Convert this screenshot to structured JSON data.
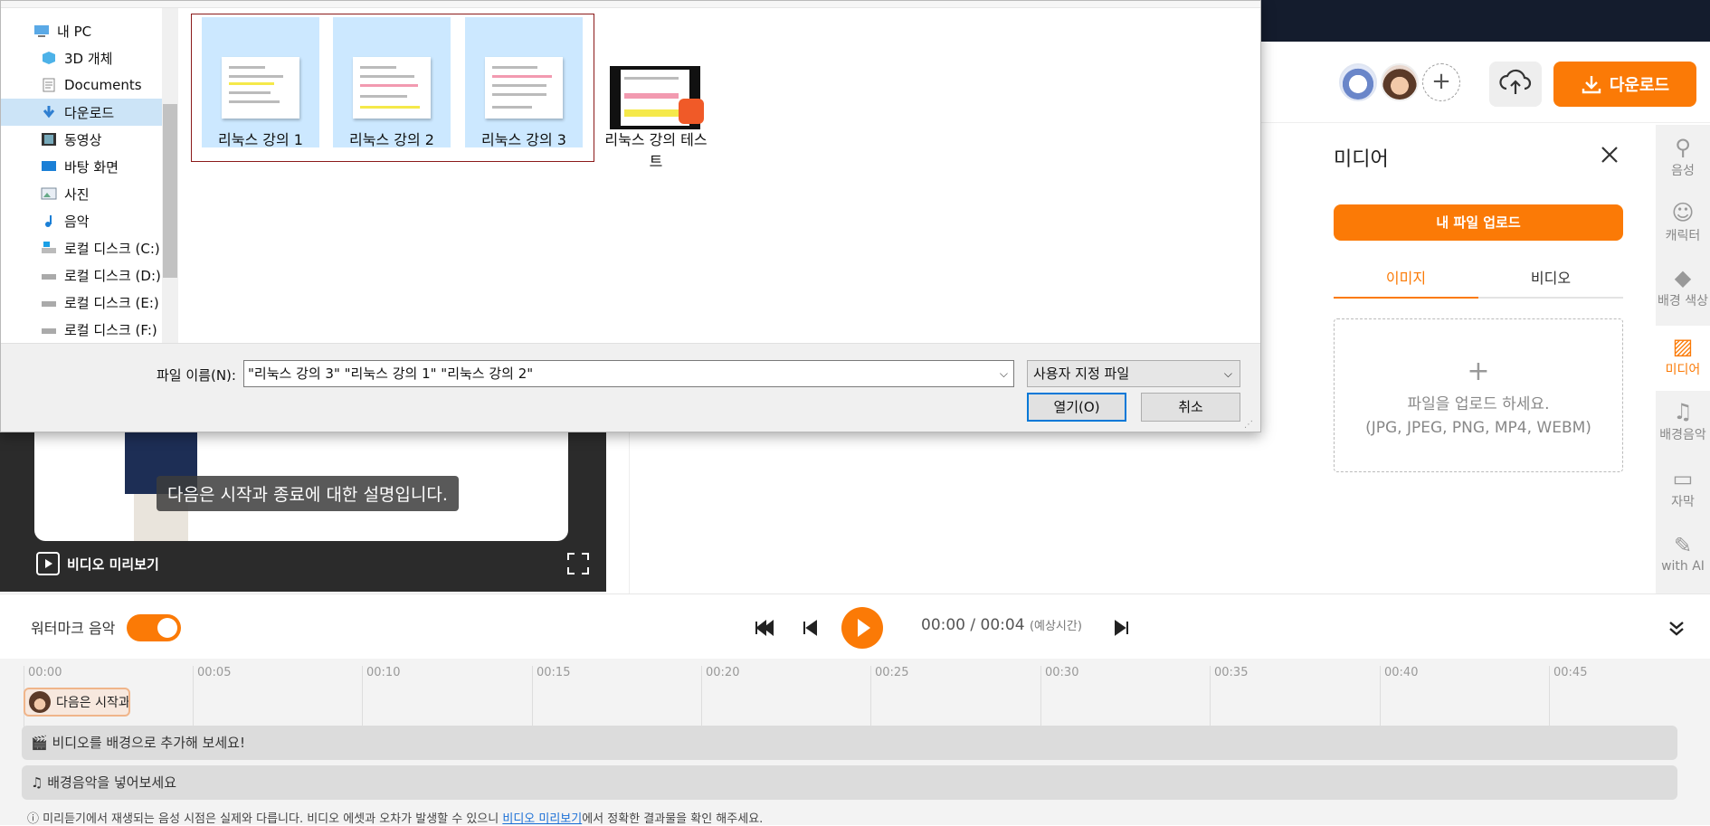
{
  "dialog": {
    "nav_items": [
      {
        "label": "내 PC",
        "icon": "pc-icon"
      },
      {
        "label": "3D 개체",
        "icon": "cube-icon"
      },
      {
        "label": "Documents",
        "icon": "document-icon"
      },
      {
        "label": "다운로드",
        "icon": "download-arrow-icon",
        "selected": true
      },
      {
        "label": "동영상",
        "icon": "film-icon"
      },
      {
        "label": "바탕 화면",
        "icon": "desktop-icon"
      },
      {
        "label": "사진",
        "icon": "picture-icon"
      },
      {
        "label": "음악",
        "icon": "music-note-icon"
      },
      {
        "label": "로컬 디스크 (C:)",
        "icon": "windows-drive-icon"
      },
      {
        "label": "로컬 디스크 (D:)",
        "icon": "drive-icon"
      },
      {
        "label": "로컬 디스크 (E:)",
        "icon": "drive-icon"
      },
      {
        "label": "로컬 디스크 (F:)",
        "icon": "drive-icon"
      }
    ],
    "files": [
      {
        "name": "리눅스 강의 1",
        "selected": true
      },
      {
        "name": "리눅스 강의 2",
        "selected": true
      },
      {
        "name": "리눅스 강의 3",
        "selected": true
      },
      {
        "name": "리눅스 강의 테스트",
        "selected": false
      }
    ],
    "filename_label": "파일 이름(N):",
    "filename_value": "\"리눅스 강의 3\" \"리눅스 강의 1\" \"리눅스 강의 2\"",
    "filetype_value": "사용자 지정 파일",
    "open_label": "열기(O)",
    "cancel_label": "취소"
  },
  "header": {
    "download_label": "다운로드",
    "add_icon": "plus-icon",
    "upload_icon": "cloud-upload-icon"
  },
  "media_panel": {
    "title": "미디어",
    "upload_button": "내 파일 업로드",
    "tabs": [
      "이미지",
      "비디오"
    ],
    "dropzone_plus": "+",
    "dropzone_line1": "파일을 업로드 하세요.",
    "dropzone_line2": "(JPG, JPEG, PNG, MP4, WEBM)"
  },
  "rail": [
    {
      "label": "음성",
      "icon": "voice-icon"
    },
    {
      "label": "캐릭터",
      "icon": "character-icon"
    },
    {
      "label": "배경 색상",
      "icon": "paint-bucket-icon"
    },
    {
      "label": "미디어",
      "icon": "image-icon",
      "active": true
    },
    {
      "label": "배경음악",
      "icon": "music-icon"
    },
    {
      "label": "자막",
      "icon": "caption-icon"
    },
    {
      "label": "with AI",
      "icon": "ai-wand-icon"
    }
  ],
  "preview": {
    "subtitle": "다음은 시작과 종료에 대한 설명입니다.",
    "label": "비디오 미리보기"
  },
  "player": {
    "watermark_label": "워터마크 음악",
    "time_current": "00:00 / 00:04",
    "time_note": "(예상시간)"
  },
  "timeline": {
    "ticks": [
      "00:00",
      "00:05",
      "00:10",
      "00:15",
      "00:20",
      "00:25",
      "00:30",
      "00:35",
      "00:40",
      "00:45"
    ],
    "clip_text": "다음은 시작과",
    "track_video": "비디오를 배경으로 추가해 보세요!",
    "track_music": "배경음악을 넣어보세요",
    "note_before": "미리듣기에서 재생되는 음성 시점은 실제와 다릅니다. 비디오 에셋과 오차가 발생할 수 있으니 ",
    "note_link": "비디오 미리보기",
    "note_after": "에서 정확한 결과물을 확인 해주세요."
  },
  "colors": {
    "accent": "#fb7a06",
    "topbar": "#141c2d",
    "selection": "#cce8ff"
  }
}
